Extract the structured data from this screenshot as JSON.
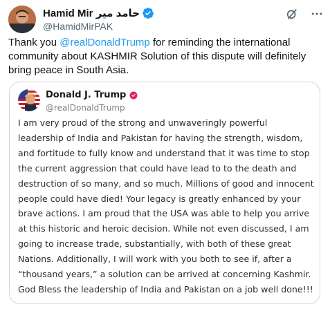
{
  "post": {
    "display_name": "Hamid Mir حامد میر",
    "handle": "@HamidMirPAK",
    "text_before": "Thank you ",
    "mention": "@realDonaldTrump",
    "text_after": " for reminding the international community about KASHMIR Solution of this dispute will definitely bring peace in South Asia."
  },
  "icons": {
    "verified": "verified-badge-icon",
    "grok": "grok-icon",
    "more": "more-icon"
  },
  "colors": {
    "verified": "#1d9bf0",
    "mention": "#1d9bf0",
    "truth_verified": "#e0245e"
  },
  "embedded": {
    "display_name": "Donald J. Trump",
    "handle": "@realDonaldTrump",
    "body": "I am very proud of the strong and unwaveringly powerful leadership of India and Pakistan for having the strength, wisdom, and fortitude to fully know and understand that it was time to stop the current aggression that could have lead to to the death and destruction of so many, and so much. Millions of good and innocent people could have died! Your legacy is greatly enhanced by your brave actions. I am proud that the USA was able to help you arrive at this historic and heroic decision. While not even discussed, I am going to increase trade, substantially, with both of these great Nations. Additionally, I will work with you both to see if, after a “thousand years,” a solution can be arrived at concerning Kashmir. God Bless the leadership of India and Pakistan on a job well done!!!"
  }
}
